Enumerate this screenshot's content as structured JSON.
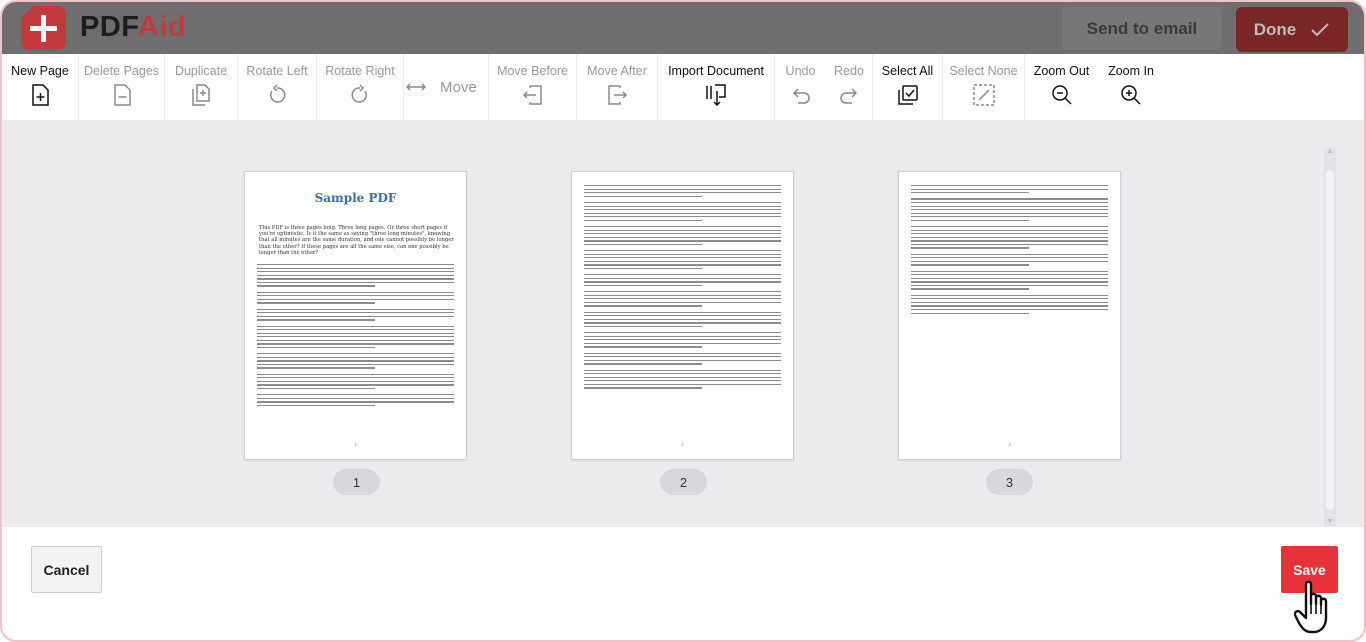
{
  "header": {
    "logo_part1": "PDF",
    "logo_part2": "Aid",
    "send_email_label": "Send to email",
    "done_label": "Done"
  },
  "toolbar": {
    "new_page": "New Page",
    "delete_pages": "Delete Pages",
    "duplicate": "Duplicate",
    "rotate_left": "Rotate Left",
    "rotate_right": "Rotate Right",
    "move": "Move",
    "move_before": "Move Before",
    "move_after": "Move After",
    "import_document": "Import Document",
    "undo": "Undo",
    "redo": "Redo",
    "select_all": "Select All",
    "select_none": "Select None",
    "zoom_out": "Zoom Out",
    "zoom_in": "Zoom In"
  },
  "pages": [
    {
      "number": "1",
      "title": "Sample PDF",
      "intro": "This PDF is three pages long. Three long pages. Or three short pages if you're optimistic. Is it the same as saying \"three long minutes\", knowing that all minutes are the same duration, and one cannot possibly be longer than the other? If these pages are all the same size, can one possibly be longer than the other?"
    },
    {
      "number": "2"
    },
    {
      "number": "3"
    }
  ],
  "footer": {
    "cancel_label": "Cancel",
    "save_label": "Save"
  }
}
